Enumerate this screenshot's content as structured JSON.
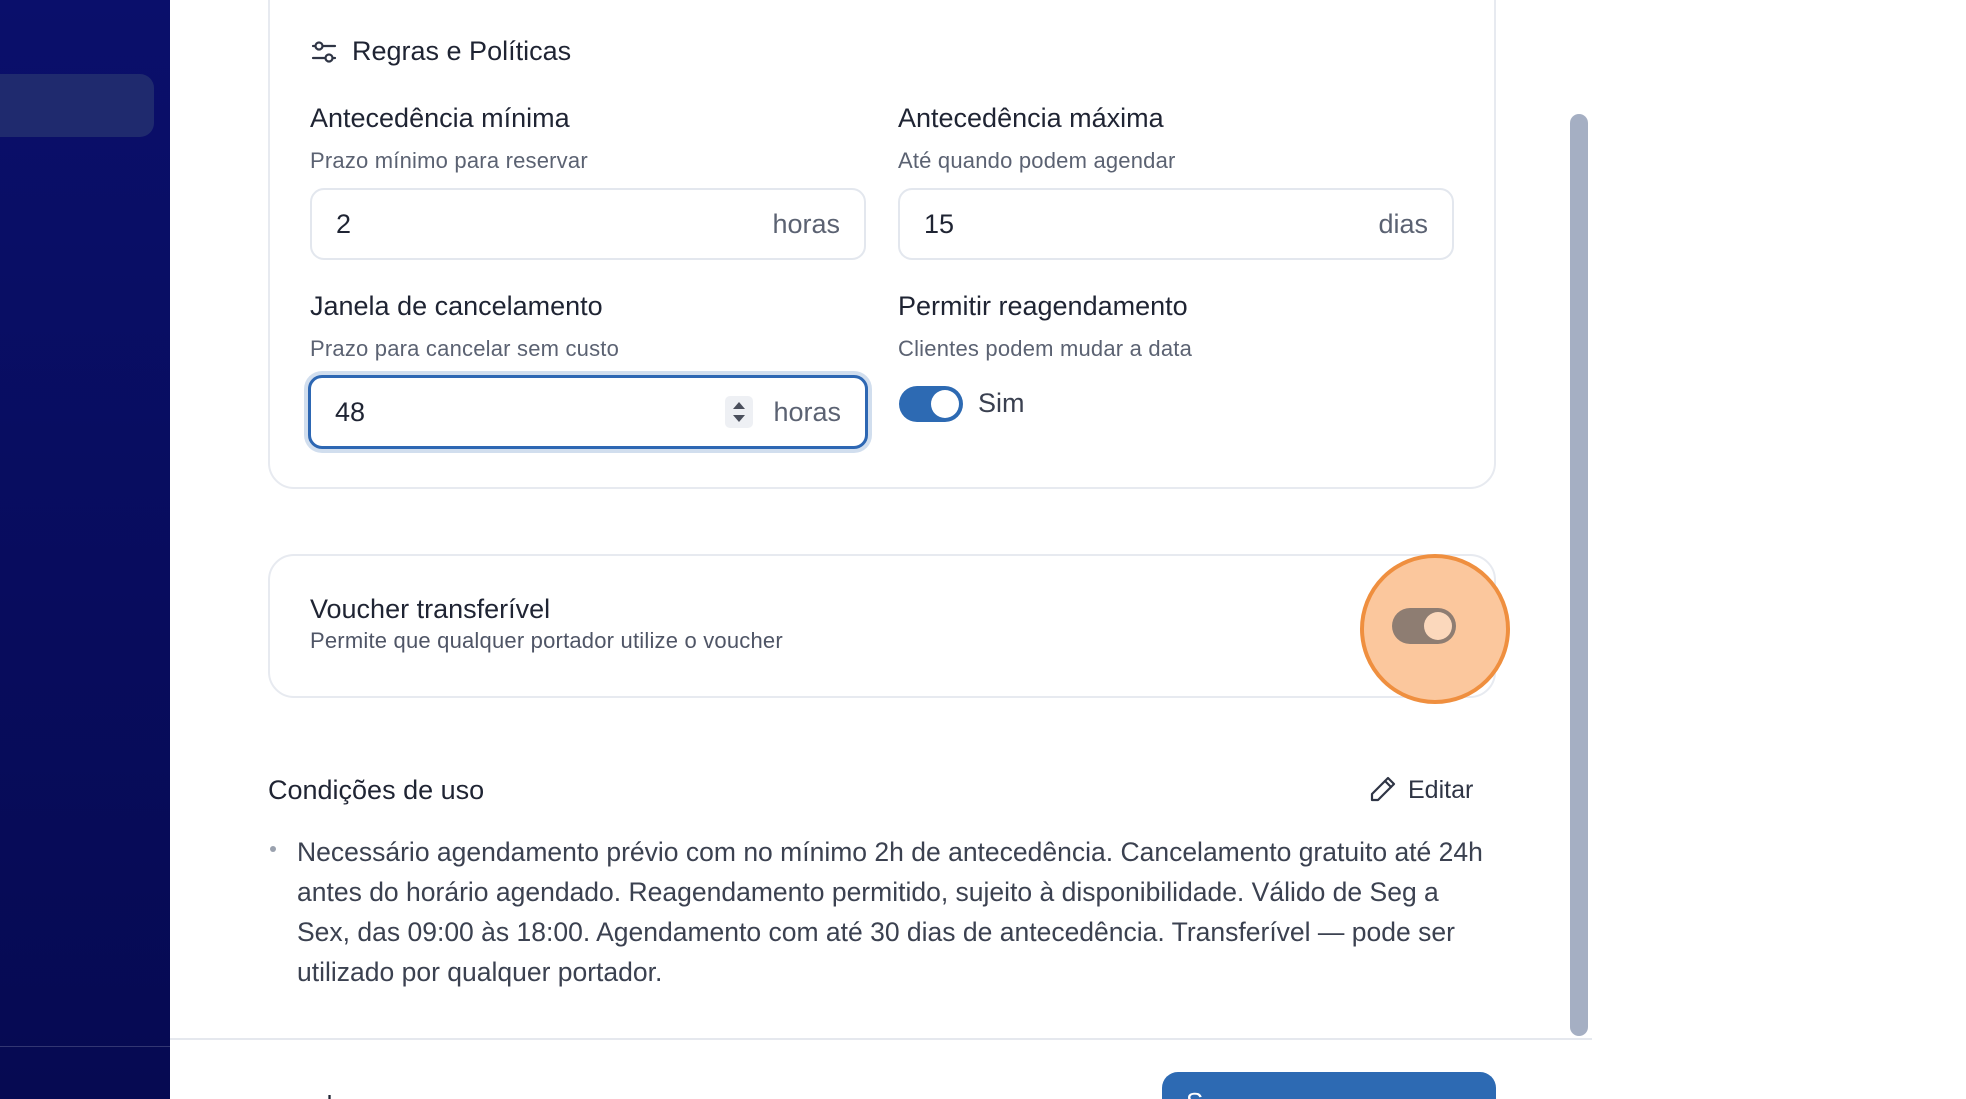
{
  "rules": {
    "title": "Regras e Políticas",
    "min_advance": {
      "label": "Antecedência mínima",
      "hint": "Prazo mínimo para reservar",
      "value": "2",
      "unit": "horas"
    },
    "max_advance": {
      "label": "Antecedência máxima",
      "hint": "Até quando podem agendar",
      "value": "15",
      "unit": "dias"
    },
    "cancel_window": {
      "label": "Janela de cancelamento",
      "hint": "Prazo para cancelar sem custo",
      "value": "48",
      "unit": "horas"
    },
    "reschedule": {
      "label": "Permitir reagendamento",
      "hint": "Clientes podem mudar a data",
      "toggle_label": "Sim",
      "enabled": true
    }
  },
  "voucher": {
    "title": "Voucher transferível",
    "hint": "Permite que qualquer portador utilize o voucher",
    "enabled": false
  },
  "conditions": {
    "title": "Condições de uso",
    "edit_label": "Editar",
    "items": [
      "Necessário agendamento prévio com no mínimo 2h de antecedência. Cancelamento gratuito até 24h antes do horário agendado. Reagendamento permitido, sujeito à disponibilidade. Válido de Seg a Sex, das 09:00 às 18:00. Agendamento com até 30 dias de antecedência. Transferível — pode ser utilizado por qualquer portador."
    ]
  },
  "footer": {
    "left_text": "...l...",
    "primary_label": "S..."
  },
  "colors": {
    "sidebar": "#0a0f6b",
    "accent": "#2d6ab3",
    "highlight": "#ef8f3f"
  }
}
